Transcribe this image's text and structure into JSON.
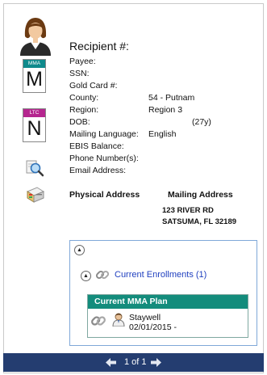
{
  "recipient": {
    "title": "Recipient #:"
  },
  "badges": {
    "mma": {
      "band_label": "MMA",
      "letter": "M",
      "band_color": "#0f8a8c"
    },
    "ltc": {
      "band_label": "LTC",
      "letter": "N",
      "band_color": "#b5268f"
    }
  },
  "fields": [
    {
      "label": "Payee:",
      "value": ""
    },
    {
      "label": "SSN:",
      "value": ""
    },
    {
      "label": "Gold Card #:",
      "value": ""
    },
    {
      "label": "County:",
      "value": "54 - Putnam"
    },
    {
      "label": "Region:",
      "value": "Region 3"
    },
    {
      "label": "DOB:",
      "value": "(27y)"
    },
    {
      "label": "Mailing Language:",
      "value": "English"
    },
    {
      "label": "EBIS Balance:",
      "value": ""
    },
    {
      "label": "Phone Number(s):",
      "value": ""
    },
    {
      "label": "Email Address:",
      "value": ""
    }
  ],
  "address": {
    "physical_label": "Physical Address",
    "mailing_label": "Mailing Address",
    "mailing_line1": "123 RIVER RD",
    "mailing_line2": "SATSUMA, FL 32189"
  },
  "enrollments": {
    "link_label": "Current Enrollments (1)",
    "plan_header": "Current MMA Plan",
    "plan_name": "Staywell",
    "plan_date": "02/01/2015 -",
    "accent_color": "#138c7c"
  },
  "pager": {
    "label": "1 of 1"
  },
  "icons": [
    "person-avatar-icon",
    "magnifier-icon",
    "address-book-icon",
    "chain-link-icon",
    "doctor-icon",
    "collapse-icon",
    "arrow-left-icon",
    "arrow-right-icon"
  ]
}
